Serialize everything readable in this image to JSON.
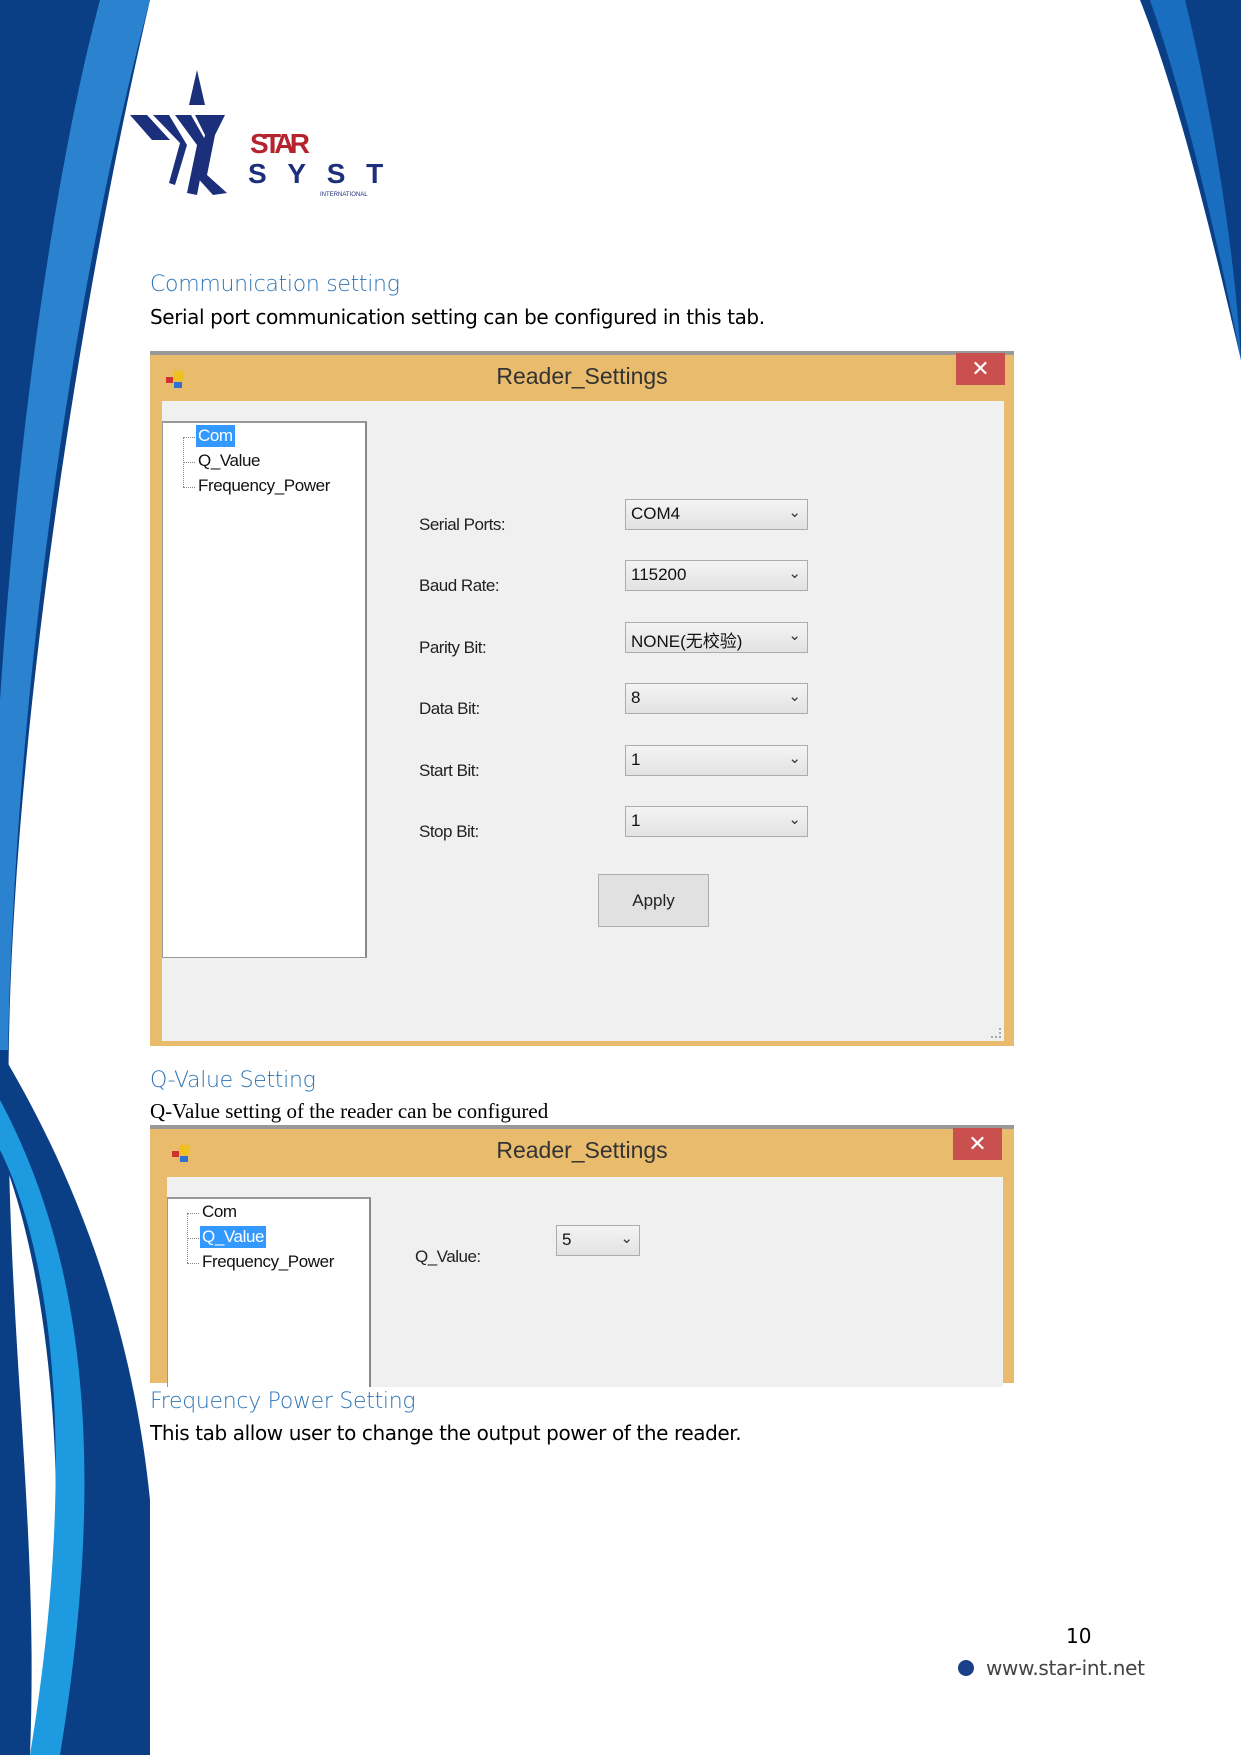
{
  "logo": {
    "line1": "STAR",
    "line2": "SYSTEMS",
    "line3": "INTERNATIONAL"
  },
  "sections": [
    {
      "heading": "Communication setting",
      "text": "Serial port communication setting can be configured in this tab."
    },
    {
      "heading": "Q-Value Setting",
      "text": "Q-Value setting of the reader can be configured"
    },
    {
      "heading": "Frequency Power Setting",
      "text": "This tab allow user to change the output power of the reader."
    }
  ],
  "dialog1": {
    "title": "Reader_Settings",
    "close": "✕",
    "tree": [
      "Com",
      "Q_Value",
      "Frequency_Power"
    ],
    "selected": "Com",
    "fields": [
      {
        "label": "Serial Ports:",
        "value": "COM4"
      },
      {
        "label": "Baud Rate:",
        "value": "115200"
      },
      {
        "label": "Parity Bit:",
        "value": "NONE(无校验)"
      },
      {
        "label": "Data Bit:",
        "value": "8"
      },
      {
        "label": "Start Bit:",
        "value": "1"
      },
      {
        "label": "Stop Bit:",
        "value": "1"
      }
    ],
    "apply": "Apply"
  },
  "dialog2": {
    "title": "Reader_Settings",
    "close": "✕",
    "tree": [
      "Com",
      "Q_Value",
      "Frequency_Power"
    ],
    "selected": "Q_Value",
    "q_label": "Q_Value:",
    "q_value": "5"
  },
  "footer": {
    "page": "10",
    "url": "www.star-int.net"
  },
  "colors": {
    "accent": "#2e74b5",
    "titlebar": "#e9bb6d",
    "close": "#c9504f",
    "select": "#3399ff"
  }
}
